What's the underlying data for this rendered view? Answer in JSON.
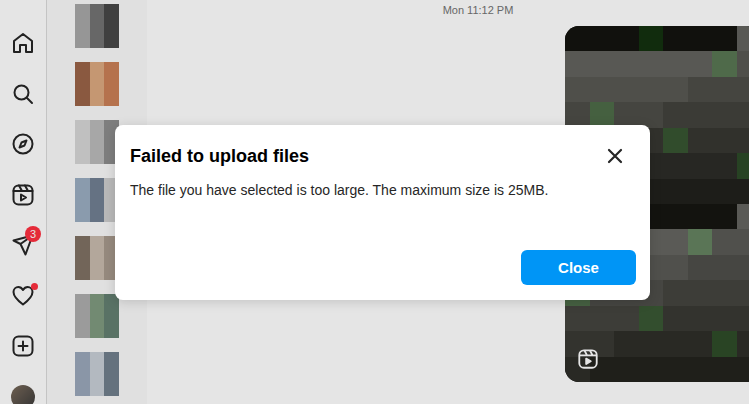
{
  "nav": [
    {
      "badge": "",
      "dot": false
    },
    {
      "badge": "",
      "dot": false
    },
    {
      "badge": "",
      "dot": false
    },
    {
      "badge": "",
      "dot": false
    },
    {
      "badge": "3",
      "dot": false
    },
    {
      "badge": "",
      "dot": true
    },
    {
      "badge": "",
      "dot": false
    }
  ],
  "thread": {
    "timestamp": "Mon 11:12 PM",
    "message": {
      "kind": "reel"
    }
  },
  "dialog": {
    "title": "Failed to upload files",
    "message": "The file you have selected is too large. The maximum size is 25MB.",
    "button": "Close"
  }
}
